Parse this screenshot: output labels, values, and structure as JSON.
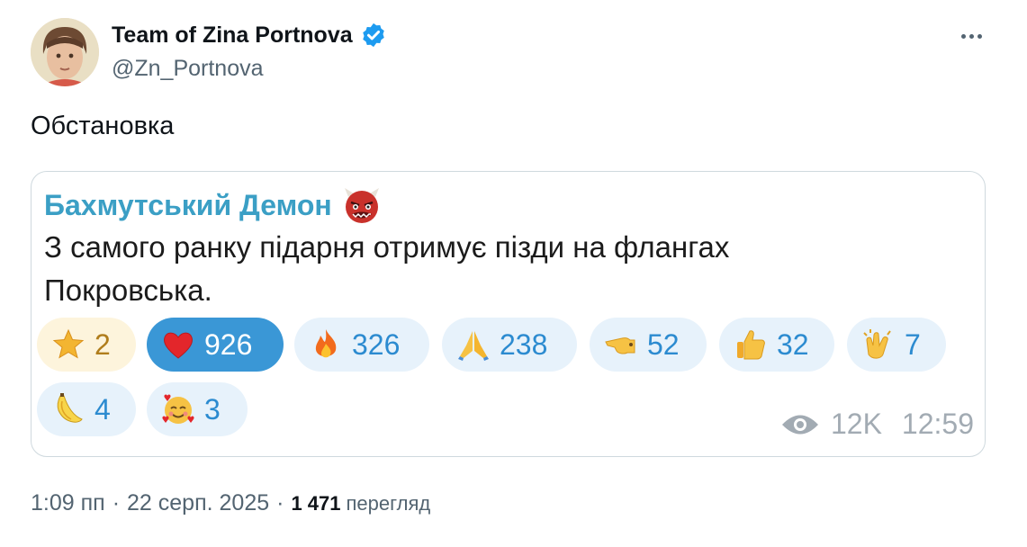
{
  "tweet": {
    "author_name": "Team of Zina Portnova",
    "handle": "@Zn_Portnova",
    "text": "Обстановка",
    "time": "1:09 пп",
    "date": "22 серп. 2025",
    "separator": "·",
    "views_count": "1 471",
    "views_label": "перегляд"
  },
  "embed": {
    "channel_name": "Бахмутський Демон",
    "text": "З самого ранку підарня отримує пізди на флангах Покровська.",
    "reactions": [
      {
        "emoji": "star-icon",
        "count": "2"
      },
      {
        "emoji": "heart-icon",
        "count": "926"
      },
      {
        "emoji": "fire-icon",
        "count": "326"
      },
      {
        "emoji": "folded-hands-icon",
        "count": "238"
      },
      {
        "emoji": "pointing-hand-icon",
        "count": "52"
      },
      {
        "emoji": "thumbs-up-icon",
        "count": "32"
      },
      {
        "emoji": "clapping-hands-icon",
        "count": "7"
      },
      {
        "emoji": "banana-icon",
        "count": "4"
      },
      {
        "emoji": "smiling-face-with-hearts-icon",
        "count": "3"
      }
    ],
    "views": "12K",
    "time": "12:59"
  },
  "colors": {
    "channel": "#3b9fc5",
    "reaction_bg": "#e7f2fb",
    "reaction_active_bg": "#3a97d6",
    "verified": "#1d9bf0"
  }
}
